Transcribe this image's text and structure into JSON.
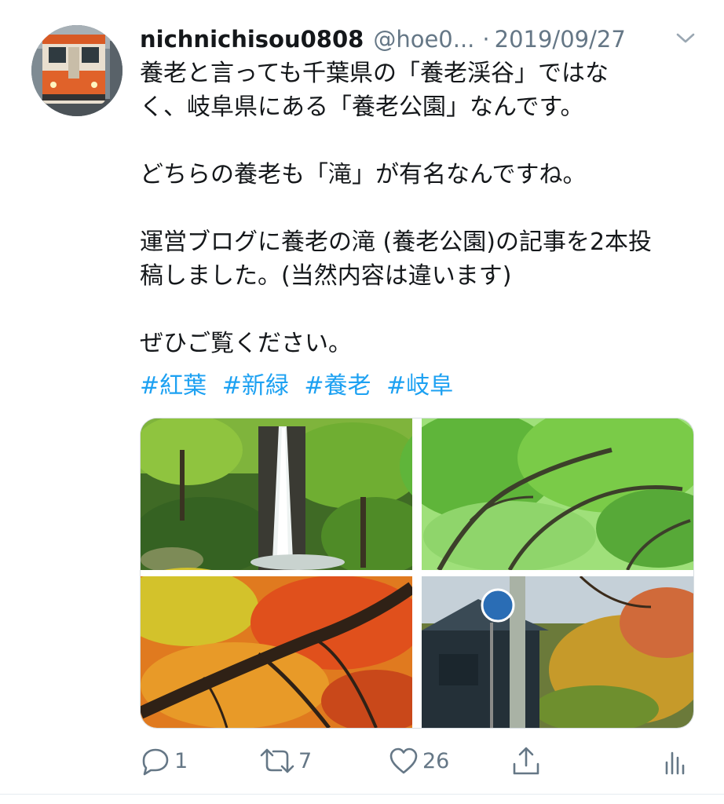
{
  "tweet": {
    "display_name": "nichnichisou0808",
    "handle": "@hoe0...",
    "separator": "·",
    "date": "2019/09/27",
    "text_lines": [
      "養老と言っても千葉県の「養老渓谷」ではな",
      "く、岐阜県にある「養老公園」なんです。",
      "",
      "どちらの養老も「滝」が有名なんですね。",
      "",
      "運営ブログに養老の滝 (養老公園)の記事を2本投",
      "稿しました。(当然内容は違います)",
      "",
      "ぜひご覧ください。"
    ],
    "hashtags": [
      "#紅葉",
      "#新緑",
      "#養老",
      "#岐阜"
    ],
    "media": [
      {
        "subject": "waterfall in green forest"
      },
      {
        "subject": "green maple trees"
      },
      {
        "subject": "autumn maple leaves"
      },
      {
        "subject": "autumn trees with road sign"
      }
    ],
    "actions": {
      "reply": {
        "icon": "reply-icon",
        "count": "1"
      },
      "retweet": {
        "icon": "retweet-icon",
        "count": "7"
      },
      "like": {
        "icon": "heart-icon",
        "count": "26"
      },
      "share": {
        "icon": "share-icon",
        "count": ""
      },
      "analytics": {
        "icon": "analytics-icon",
        "count": ""
      }
    }
  },
  "colors": {
    "link": "#1da1f2",
    "secondary_text": "#657786",
    "primary_text": "#14171a",
    "divider": "#e6ecf0"
  }
}
